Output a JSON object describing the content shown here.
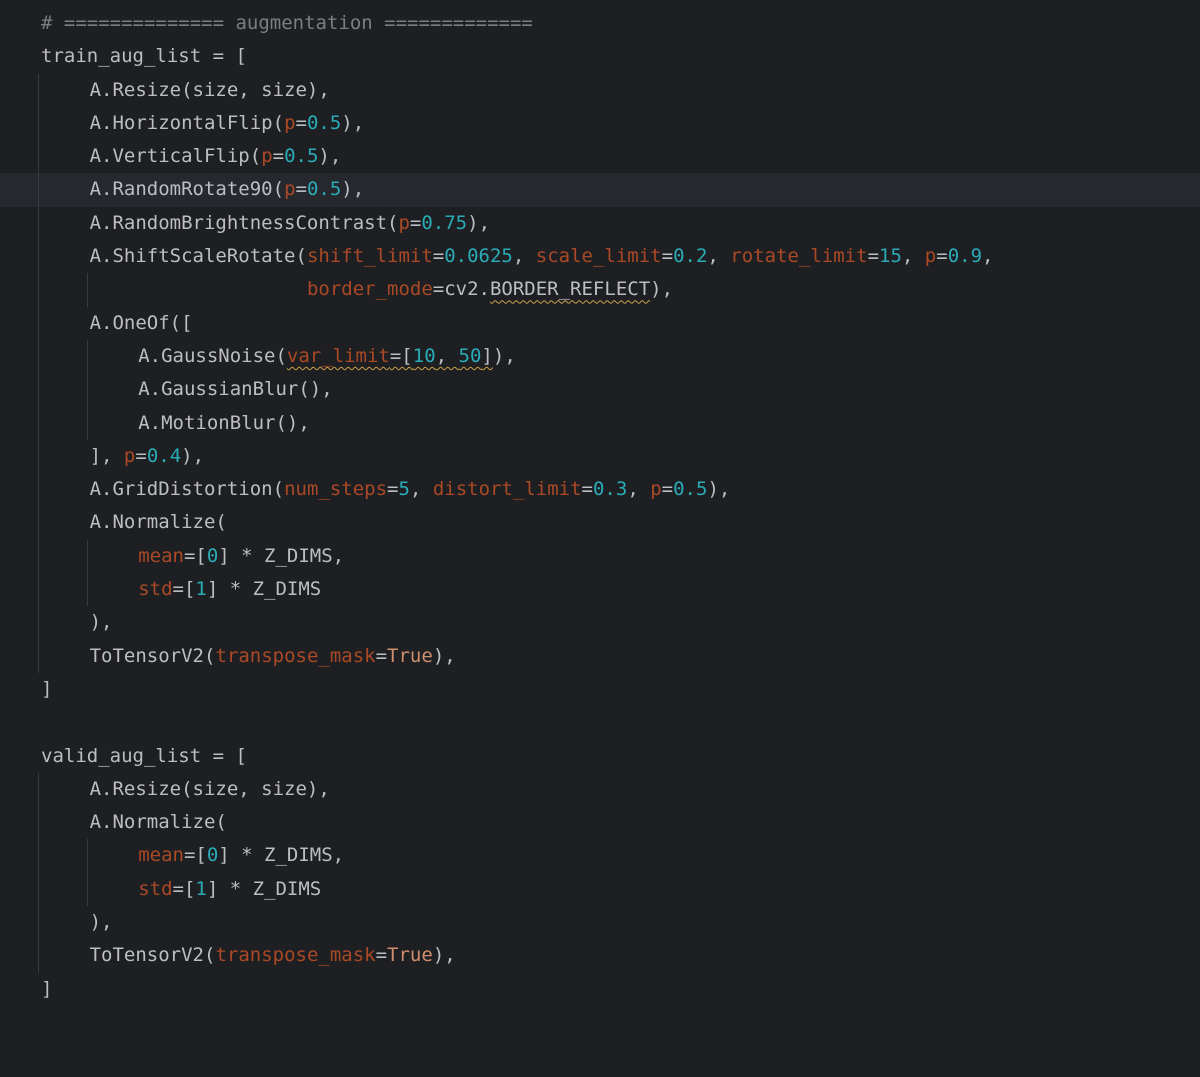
{
  "colors": {
    "background": "#1e1f22",
    "current_line": "#26282e",
    "default_text": "#bcbec4",
    "comment": "#7a7e85",
    "number": "#2aacb8",
    "parameter": "#aa4926",
    "keyword": "#cf8e6d",
    "warning_underline": "#c9a24a",
    "indent_guide": "#393b40"
  },
  "current_line_index": 5,
  "lines": [
    {
      "indent": 0,
      "tokens": [
        {
          "t": "# ============== augmentation =============",
          "c": "com"
        }
      ]
    },
    {
      "indent": 0,
      "tokens": [
        {
          "t": "train_aug_list = [",
          "c": "name"
        }
      ]
    },
    {
      "indent": 1,
      "tokens": [
        {
          "t": "A.Resize(size, size),",
          "c": "name"
        }
      ]
    },
    {
      "indent": 1,
      "tokens": [
        {
          "t": "A.HorizontalFlip(",
          "c": "name"
        },
        {
          "t": "p",
          "c": "param"
        },
        {
          "t": "=",
          "c": "op"
        },
        {
          "t": "0.5",
          "c": "num"
        },
        {
          "t": "),",
          "c": "name"
        }
      ]
    },
    {
      "indent": 1,
      "tokens": [
        {
          "t": "A.VerticalFlip(",
          "c": "name"
        },
        {
          "t": "p",
          "c": "param"
        },
        {
          "t": "=",
          "c": "op"
        },
        {
          "t": "0.5",
          "c": "num"
        },
        {
          "t": "),",
          "c": "name"
        }
      ]
    },
    {
      "indent": 1,
      "tokens": [
        {
          "t": "A.RandomRotate90(",
          "c": "name"
        },
        {
          "t": "p",
          "c": "param"
        },
        {
          "t": "=",
          "c": "op"
        },
        {
          "t": "0.5",
          "c": "num"
        },
        {
          "t": "),",
          "c": "name"
        }
      ]
    },
    {
      "indent": 1,
      "tokens": [
        {
          "t": "A.RandomBrightnessContrast(",
          "c": "name"
        },
        {
          "t": "p",
          "c": "param"
        },
        {
          "t": "=",
          "c": "op"
        },
        {
          "t": "0.75",
          "c": "num"
        },
        {
          "t": "),",
          "c": "name"
        }
      ]
    },
    {
      "indent": 1,
      "tokens": [
        {
          "t": "A.ShiftScaleRotate(",
          "c": "name"
        },
        {
          "t": "shift_limit",
          "c": "param"
        },
        {
          "t": "=",
          "c": "op"
        },
        {
          "t": "0.0625",
          "c": "num"
        },
        {
          "t": ", ",
          "c": "name"
        },
        {
          "t": "scale_limit",
          "c": "param"
        },
        {
          "t": "=",
          "c": "op"
        },
        {
          "t": "0.2",
          "c": "num"
        },
        {
          "t": ", ",
          "c": "name"
        },
        {
          "t": "rotate_limit",
          "c": "param"
        },
        {
          "t": "=",
          "c": "op"
        },
        {
          "t": "15",
          "c": "num"
        },
        {
          "t": ", ",
          "c": "name"
        },
        {
          "t": "p",
          "c": "param"
        },
        {
          "t": "=",
          "c": "op"
        },
        {
          "t": "0.9",
          "c": "num"
        },
        {
          "t": ",",
          "c": "name"
        }
      ]
    },
    {
      "indent": 1,
      "cont": true,
      "tokens": [
        {
          "t": "                   ",
          "c": "name"
        },
        {
          "t": "border_mode",
          "c": "param"
        },
        {
          "t": "=cv2.",
          "c": "name"
        },
        {
          "t": "BORDER_REFLECT",
          "c": "name",
          "warn": true
        },
        {
          "t": "),",
          "c": "name"
        }
      ]
    },
    {
      "indent": 1,
      "tokens": [
        {
          "t": "A.OneOf([",
          "c": "name"
        }
      ]
    },
    {
      "indent": 2,
      "tokens": [
        {
          "t": "A.GaussNoise(",
          "c": "name"
        },
        {
          "t": "var_limit",
          "c": "param",
          "warn": true
        },
        {
          "t": "=[",
          "c": "name",
          "warn": true
        },
        {
          "t": "10",
          "c": "num",
          "warn": true
        },
        {
          "t": ", ",
          "c": "name",
          "warn": true
        },
        {
          "t": "50",
          "c": "num",
          "warn": true
        },
        {
          "t": "]",
          "c": "name",
          "warn": true
        },
        {
          "t": "),",
          "c": "name"
        }
      ]
    },
    {
      "indent": 2,
      "tokens": [
        {
          "t": "A.GaussianBlur(),",
          "c": "name"
        }
      ]
    },
    {
      "indent": 2,
      "tokens": [
        {
          "t": "A.MotionBlur(),",
          "c": "name"
        }
      ]
    },
    {
      "indent": 1,
      "tokens": [
        {
          "t": "], ",
          "c": "name"
        },
        {
          "t": "p",
          "c": "param"
        },
        {
          "t": "=",
          "c": "op"
        },
        {
          "t": "0.4",
          "c": "num"
        },
        {
          "t": "),",
          "c": "name"
        }
      ]
    },
    {
      "indent": 1,
      "tokens": [
        {
          "t": "A.GridDistortion(",
          "c": "name"
        },
        {
          "t": "num_steps",
          "c": "param"
        },
        {
          "t": "=",
          "c": "op"
        },
        {
          "t": "5",
          "c": "num"
        },
        {
          "t": ", ",
          "c": "name"
        },
        {
          "t": "distort_limit",
          "c": "param"
        },
        {
          "t": "=",
          "c": "op"
        },
        {
          "t": "0.3",
          "c": "num"
        },
        {
          "t": ", ",
          "c": "name"
        },
        {
          "t": "p",
          "c": "param"
        },
        {
          "t": "=",
          "c": "op"
        },
        {
          "t": "0.5",
          "c": "num"
        },
        {
          "t": "),",
          "c": "name"
        }
      ]
    },
    {
      "indent": 1,
      "tokens": [
        {
          "t": "A.Normalize(",
          "c": "name"
        }
      ]
    },
    {
      "indent": 2,
      "tokens": [
        {
          "t": "mean",
          "c": "param"
        },
        {
          "t": "=[",
          "c": "name"
        },
        {
          "t": "0",
          "c": "num"
        },
        {
          "t": "] * Z_DIMS,",
          "c": "name"
        }
      ]
    },
    {
      "indent": 2,
      "tokens": [
        {
          "t": "std",
          "c": "param"
        },
        {
          "t": "=[",
          "c": "name"
        },
        {
          "t": "1",
          "c": "num"
        },
        {
          "t": "] * Z_DIMS",
          "c": "name"
        }
      ]
    },
    {
      "indent": 1,
      "tokens": [
        {
          "t": "),",
          "c": "name"
        }
      ]
    },
    {
      "indent": 1,
      "tokens": [
        {
          "t": "ToTensorV2(",
          "c": "name"
        },
        {
          "t": "transpose_mask",
          "c": "param"
        },
        {
          "t": "=",
          "c": "op"
        },
        {
          "t": "True",
          "c": "kw"
        },
        {
          "t": "),",
          "c": "name"
        }
      ]
    },
    {
      "indent": 0,
      "tokens": [
        {
          "t": "]",
          "c": "name"
        }
      ]
    },
    {
      "indent": 0,
      "tokens": []
    },
    {
      "indent": 0,
      "tokens": [
        {
          "t": "valid_aug_list = [",
          "c": "name"
        }
      ]
    },
    {
      "indent": 1,
      "tokens": [
        {
          "t": "A.Resize(size, size),",
          "c": "name"
        }
      ]
    },
    {
      "indent": 1,
      "tokens": [
        {
          "t": "A.Normalize(",
          "c": "name"
        }
      ]
    },
    {
      "indent": 2,
      "tokens": [
        {
          "t": "mean",
          "c": "param"
        },
        {
          "t": "=[",
          "c": "name"
        },
        {
          "t": "0",
          "c": "num"
        },
        {
          "t": "] * Z_DIMS,",
          "c": "name"
        }
      ]
    },
    {
      "indent": 2,
      "tokens": [
        {
          "t": "std",
          "c": "param"
        },
        {
          "t": "=[",
          "c": "name"
        },
        {
          "t": "1",
          "c": "num"
        },
        {
          "t": "] * Z_DIMS",
          "c": "name"
        }
      ]
    },
    {
      "indent": 1,
      "tokens": [
        {
          "t": "),",
          "c": "name"
        }
      ]
    },
    {
      "indent": 1,
      "tokens": [
        {
          "t": "ToTensorV2(",
          "c": "name"
        },
        {
          "t": "transpose_mask",
          "c": "param"
        },
        {
          "t": "=",
          "c": "op"
        },
        {
          "t": "True",
          "c": "kw"
        },
        {
          "t": "),",
          "c": "name"
        }
      ]
    },
    {
      "indent": 0,
      "tokens": [
        {
          "t": "]",
          "c": "name"
        }
      ]
    }
  ]
}
